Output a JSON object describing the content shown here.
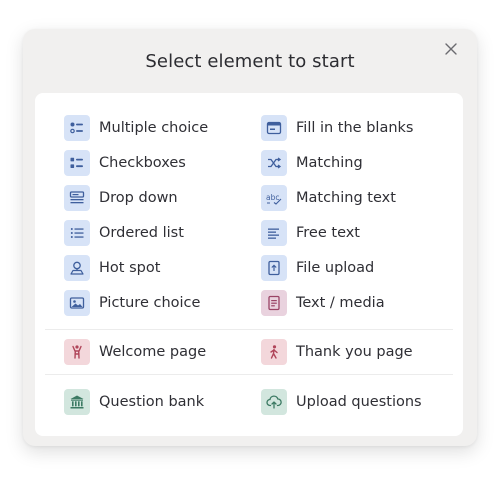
{
  "dialog": {
    "title": "Select element to start",
    "close_icon": "close-icon"
  },
  "colors": {
    "overlay_background": "#f1f0ef",
    "panel_background": "#ffffff",
    "icon_blue_bg": "#d7e3f7",
    "icon_blue_fg": "#3f5f9d",
    "icon_pink_bg": "#f3d7db",
    "icon_pink_fg": "#b0455a",
    "icon_green_bg": "#d2e6de",
    "icon_green_fg": "#3c7a63"
  },
  "question_types": [
    {
      "label": "Multiple choice",
      "icon": "multiple-choice-icon"
    },
    {
      "label": "Fill in the blanks",
      "icon": "fill-blanks-icon"
    },
    {
      "label": "Checkboxes",
      "icon": "checkboxes-icon"
    },
    {
      "label": "Matching",
      "icon": "shuffle-icon"
    },
    {
      "label": "Drop down",
      "icon": "dropdown-icon"
    },
    {
      "label": "Matching text",
      "icon": "abc-icon"
    },
    {
      "label": "Ordered list",
      "icon": "ordered-list-icon"
    },
    {
      "label": "Free text",
      "icon": "text-lines-icon"
    },
    {
      "label": "Hot spot",
      "icon": "hotspot-pin-icon"
    },
    {
      "label": "File upload",
      "icon": "file-upload-icon"
    },
    {
      "label": "Picture choice",
      "icon": "image-icon"
    },
    {
      "label": "Text / media",
      "icon": "document-icon"
    }
  ],
  "pages": [
    {
      "label": "Welcome page",
      "icon": "person-wave-icon"
    },
    {
      "label": "Thank you page",
      "icon": "person-walk-icon"
    }
  ],
  "sources": [
    {
      "label": "Question bank",
      "icon": "bank-icon"
    },
    {
      "label": "Upload questions",
      "icon": "cloud-upload-icon"
    }
  ]
}
